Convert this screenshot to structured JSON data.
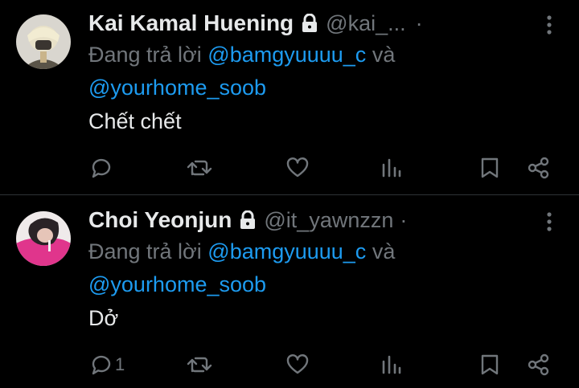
{
  "colors": {
    "background": "#000000",
    "text": "#e7e9ea",
    "muted": "#71767b",
    "link": "#1d9bf0",
    "divider": "#2f3336"
  },
  "replies": [
    {
      "name": "Kai Kamal Huening",
      "handle": "@kai_...",
      "separator": "·",
      "replying_prefix": "Đang trả lời",
      "mention_1": "@bamgyuuuu_c",
      "conjunction": "và",
      "mention_2": "@yourhome_soob",
      "text": "Chết chết",
      "reply_count": "",
      "icons": [
        "lock-icon",
        "more-icon",
        "reply-icon",
        "retweet-icon",
        "like-icon",
        "views-icon",
        "bookmark-icon",
        "share-icon"
      ]
    },
    {
      "name": "Choi Yeonjun",
      "handle": "@it_yawnzzn",
      "separator": "·",
      "replying_prefix": "Đang trả lời",
      "mention_1": "@bamgyuuuu_c",
      "conjunction": "và",
      "mention_2": "@yourhome_soob",
      "text": "Dở",
      "reply_count": "1",
      "icons": [
        "lock-icon",
        "more-icon",
        "reply-icon",
        "retweet-icon",
        "like-icon",
        "views-icon",
        "bookmark-icon",
        "share-icon"
      ]
    }
  ]
}
